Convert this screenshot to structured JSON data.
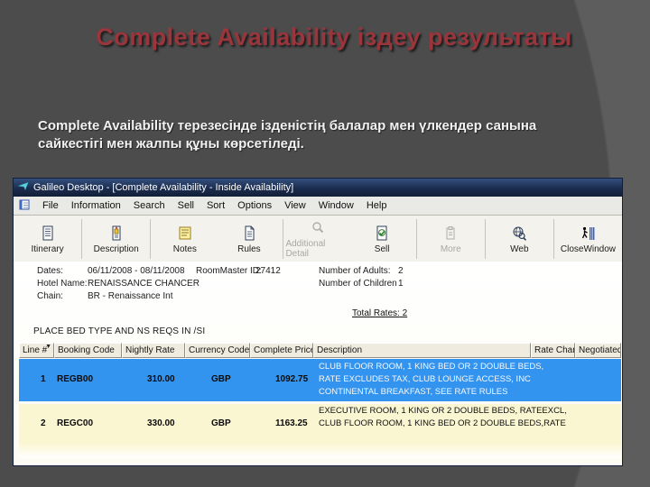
{
  "slide": {
    "title": "Complete Availability іздеу результаты",
    "body": "Complete Availability  терезесінде ізденістің балалар мен үлкендер санына сайкестігі мен жалпы құны көрсетіледі."
  },
  "window": {
    "title": "Galileo Desktop - [Complete Availability - Inside Availability]",
    "menu": [
      "File",
      "Information",
      "Search",
      "Sell",
      "Sort",
      "Options",
      "View",
      "Window",
      "Help"
    ],
    "toolbar": [
      {
        "label": "Itinerary",
        "icon": "itinerary-icon",
        "enabled": true
      },
      {
        "label": "Description",
        "icon": "description-icon",
        "enabled": true
      },
      {
        "label": "Notes",
        "icon": "notes-icon",
        "enabled": true
      },
      {
        "label": "Rules",
        "icon": "rules-icon",
        "enabled": true
      },
      {
        "label": "Additional Detail",
        "icon": "additional-detail-icon",
        "enabled": false
      },
      {
        "label": "Sell",
        "icon": "sell-icon",
        "enabled": true
      },
      {
        "label": "More",
        "icon": "more-icon",
        "enabled": false
      },
      {
        "label": "Web",
        "icon": "web-icon",
        "enabled": true
      },
      {
        "label": "CloseWindow",
        "icon": "close-window-icon",
        "enabled": true
      }
    ],
    "form": {
      "dates_label": "Dates:",
      "dates_value": "06/11/2008 - 08/11/2008",
      "hotel_label": "Hotel Name:",
      "hotel_value": "RENAISSANCE CHANCER",
      "chain_label": "Chain:",
      "chain_value": "BR - Renaissance Int",
      "roommaster_label": "RoomMaster ID:",
      "roommaster_value": "27412",
      "adults_label": "Number of Adults:",
      "adults_value": "2",
      "children_label": "Number of Children",
      "children_value": "1",
      "total_rates_label": "Total Rates:",
      "total_rates_value": "2"
    },
    "notice": "PLACE BED TYPE AND NS REQS IN /SI",
    "table": {
      "columns": [
        "Line #",
        "Booking Code",
        "Nightly Rate",
        "Currency Code",
        "Complete Price",
        "Description",
        "Rate Changes",
        "Negotiated"
      ],
      "rows": [
        {
          "line": "1",
          "booking_code": "REGB00",
          "nightly_rate": "310.00",
          "currency": "GBP",
          "complete_price": "1092.75",
          "selected": true,
          "description": [
            "CLUB FLOOR ROOM, 1 KING BED OR 2 DOUBLE BEDS,",
            "RATE EXCLUDES TAX, CLUB LOUNGE ACCESS, INC",
            "CONTINENTAL BREAKFAST, SEE RATE RULES"
          ]
        },
        {
          "line": "2",
          "booking_code": "REGC00",
          "nightly_rate": "330.00",
          "currency": "GBP",
          "complete_price": "1163.25",
          "selected": false,
          "description": [
            "EXECUTIVE ROOM, 1 KING OR 2 DOUBLE BEDS, RATEEXCL,",
            "CLUB FLOOR ROOM, 1 KING BED OR 2 DOUBLE BEDS,RATE"
          ]
        }
      ]
    }
  },
  "colors": {
    "selected_row": "#3394f0",
    "alt_row": "#fbf6d2",
    "header_bg": "#efecdf",
    "titlebar": "#1b2c4e",
    "slide_title": "#9a353c"
  }
}
